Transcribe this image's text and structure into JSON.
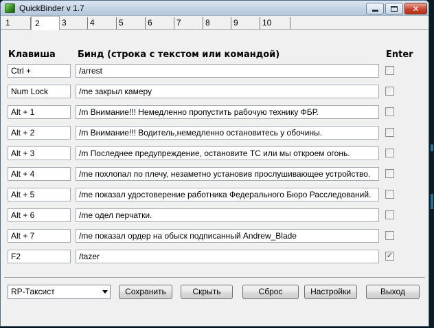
{
  "window": {
    "title": "QuickBinder v 1.7"
  },
  "tabs": [
    "1",
    "2",
    "3",
    "4",
    "5",
    "6",
    "7",
    "8",
    "9",
    "10"
  ],
  "active_tab": "2",
  "headers": {
    "key": "Клавиша",
    "bind": "Бинд (строка с текстом или командой)",
    "enter": "Enter"
  },
  "rows": [
    {
      "key": "Ctrl +",
      "bind": "/arrest",
      "enter": false
    },
    {
      "key": "Num Lock",
      "bind": "/me закрыл камеру",
      "enter": false
    },
    {
      "key": "Alt + 1",
      "bind": "/m Внимание!!! Немедленно пропустить рабочую технику ФБР.",
      "enter": false
    },
    {
      "key": "Alt + 2",
      "bind": "/m Внимание!!! Водитель,немедленно остановитесь у обочины.",
      "enter": false
    },
    {
      "key": "Alt + 3",
      "bind": "/m Последнее предупреждение, остановите ТС или мы откроем огонь.",
      "enter": false
    },
    {
      "key": "Alt + 4",
      "bind": "/me похлопал по плечу, незаметно установив прослушивающее устройство.",
      "enter": false
    },
    {
      "key": "Alt + 5",
      "bind": "/me показал удостоверение работника Федерального Бюро Расследований.",
      "enter": false
    },
    {
      "key": "Alt + 6",
      "bind": "/me одел перчатки.",
      "enter": false
    },
    {
      "key": "Alt + 7",
      "bind": "/me показал ордер на обыск подписанный Andrew_Blade",
      "enter": false
    },
    {
      "key": "F2",
      "bind": "/tazer",
      "enter": true
    }
  ],
  "profile": {
    "selected": "RP-Таксист"
  },
  "buttons": {
    "save": "Сохранить",
    "hide": "Скрыть",
    "reset": "Сброс",
    "settings": "Настройки",
    "exit": "Выход"
  },
  "icons": {
    "app": "app-icon",
    "minimize": "minimize-icon",
    "maximize": "maximize-icon",
    "close": "close-icon",
    "dropdown": "chevron-down-icon",
    "check": "checkmark-icon"
  },
  "colors": {
    "titlebar": "#c3d3e4",
    "close_button": "#c9452f",
    "window_bg": "#f0f0f0",
    "checkmark": "#1d3d7a"
  }
}
